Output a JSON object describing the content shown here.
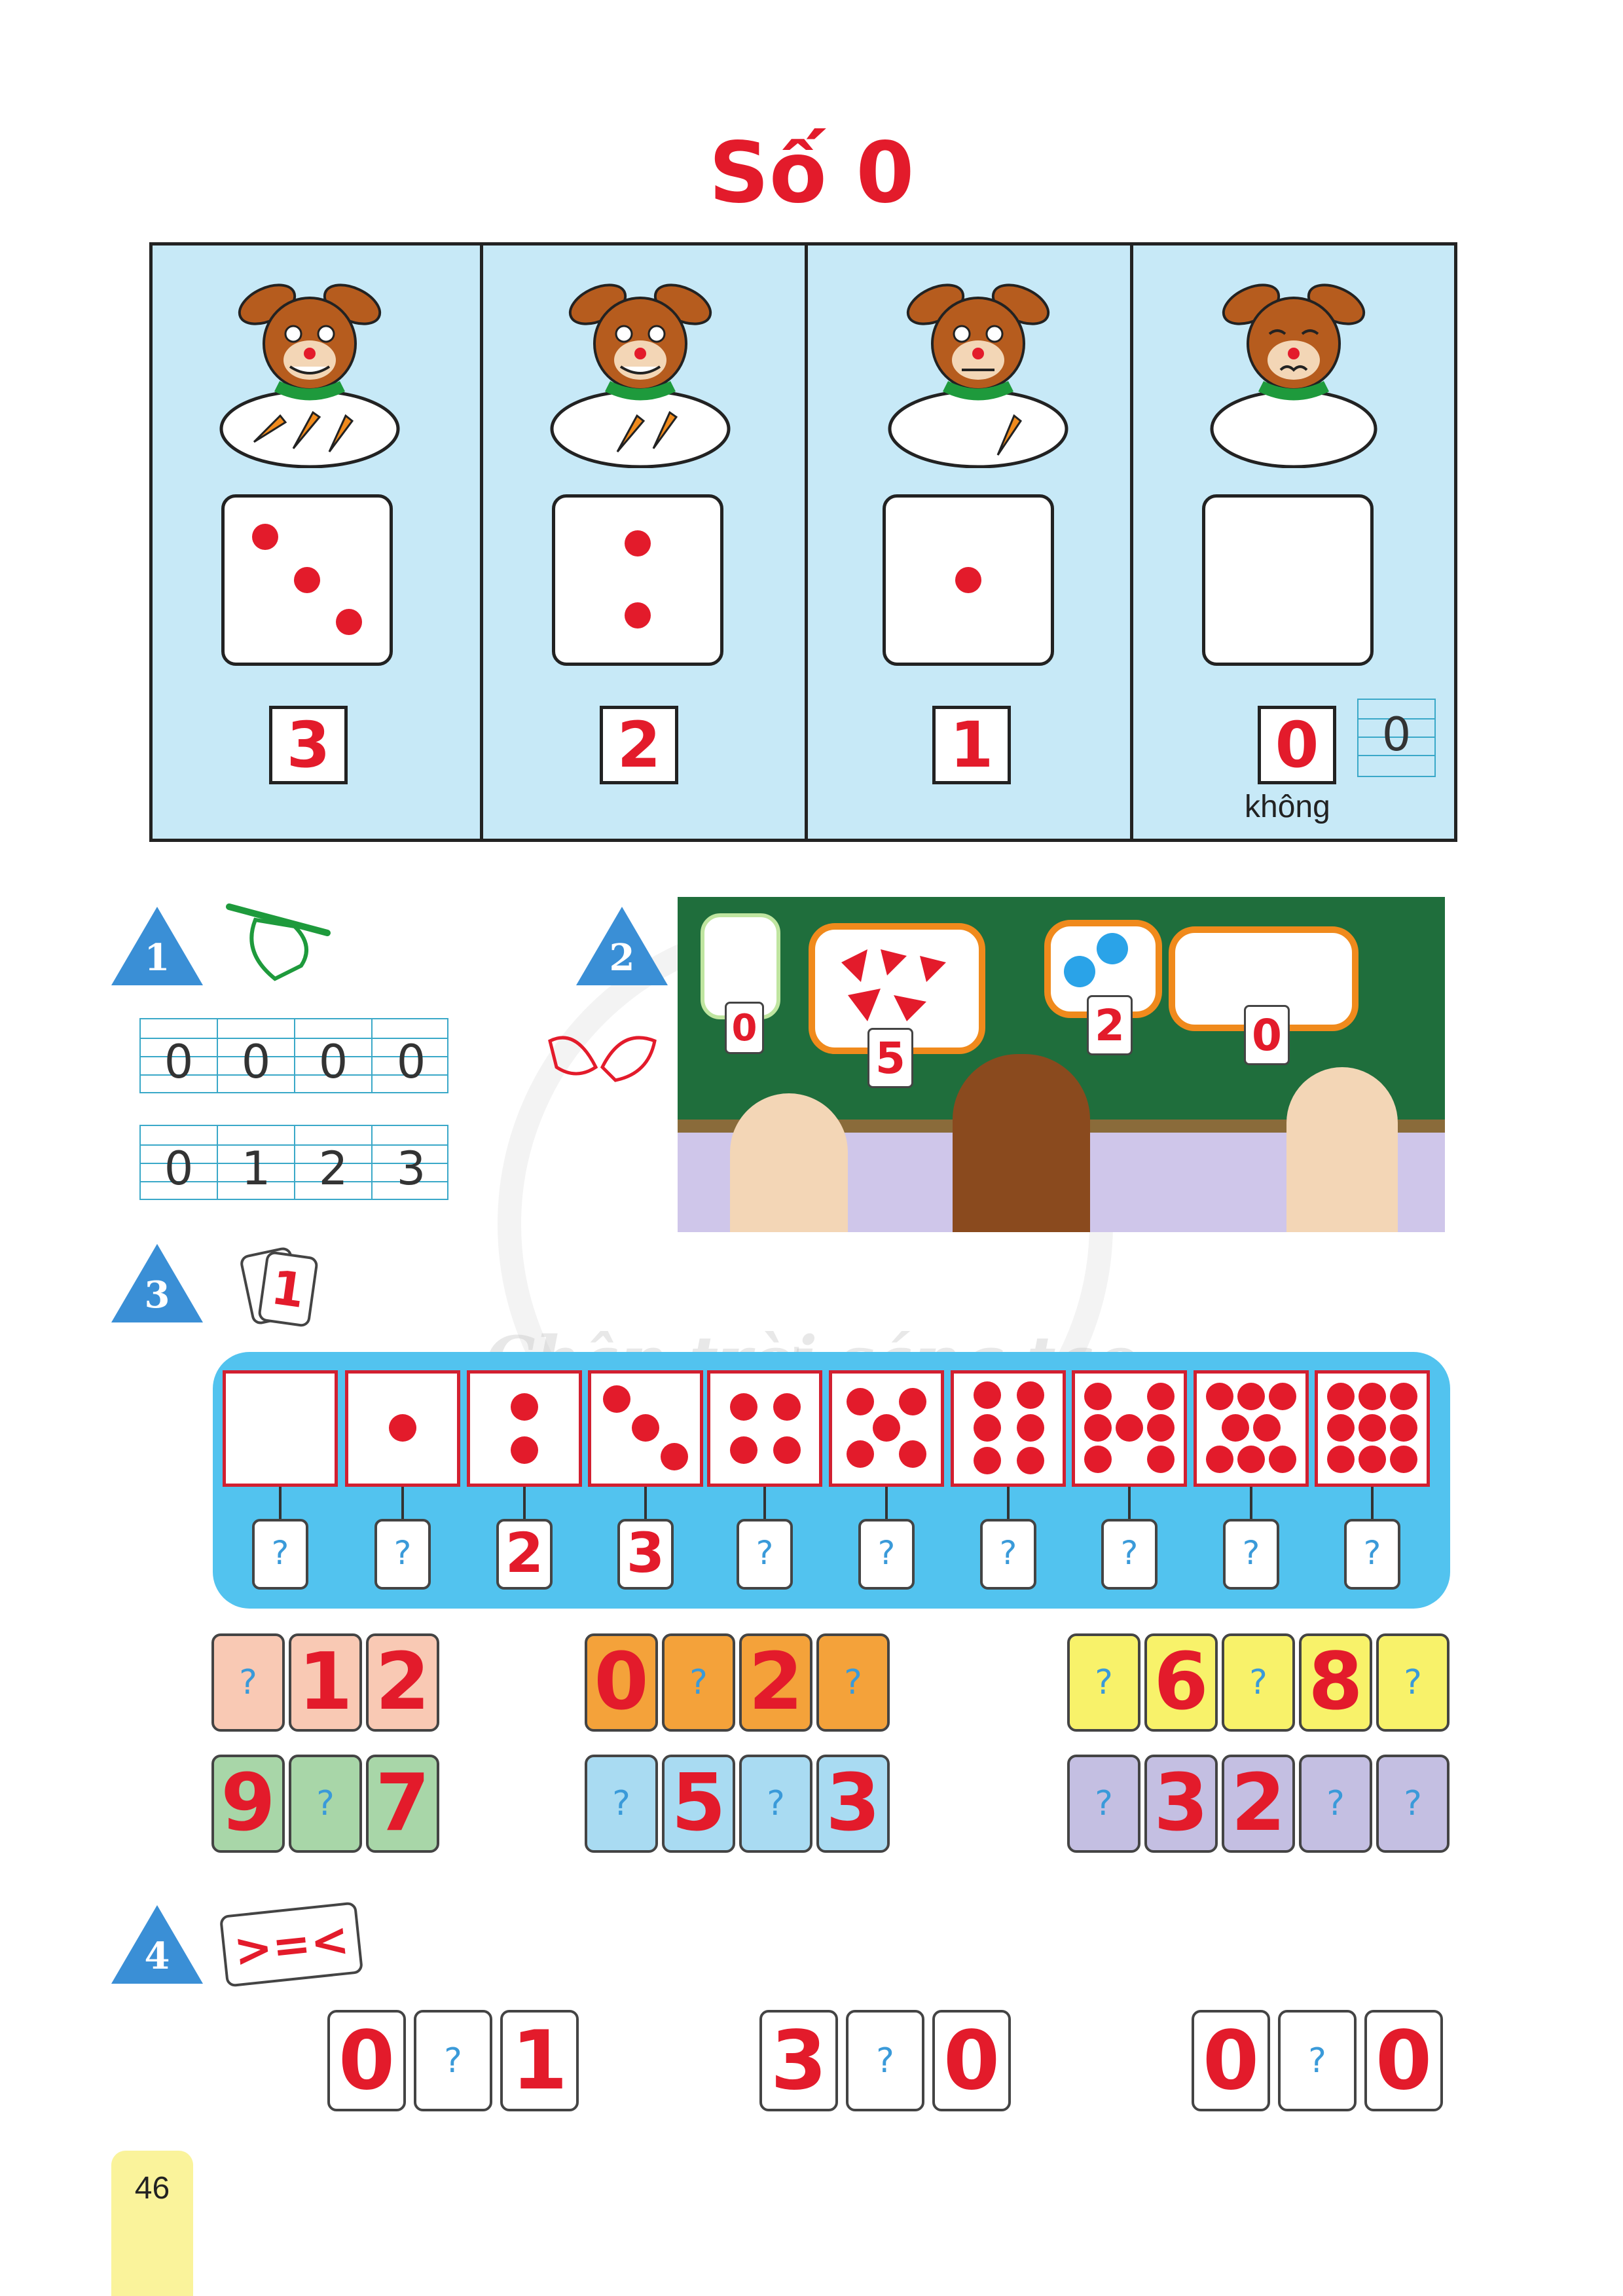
{
  "title": "Số 0",
  "hero": {
    "columns": [
      {
        "count": "3",
        "carrots": 3
      },
      {
        "count": "2",
        "carrots": 2
      },
      {
        "count": "1",
        "carrots": 1
      },
      {
        "count": "0",
        "carrots": 0,
        "word": "không",
        "write_sample": "0"
      }
    ]
  },
  "exercise1": {
    "number": "1",
    "row1": [
      "0",
      "0",
      "0",
      "0"
    ],
    "row2": [
      "0",
      "1",
      "2",
      "3"
    ]
  },
  "exercise2": {
    "number": "2",
    "cards": [
      "0",
      "5",
      "2",
      "0"
    ]
  },
  "exercise3": {
    "number": "3",
    "icon_card": "1",
    "answers": [
      "?",
      "?",
      "2",
      "3",
      "?",
      "?",
      "?",
      "?",
      "?",
      "?"
    ],
    "sequences": [
      {
        "color": "#f9c9b4",
        "items": [
          "?",
          "1",
          "2"
        ]
      },
      {
        "color": "#f4a23a",
        "items": [
          "0",
          "?",
          "2",
          "?"
        ]
      },
      {
        "color": "#f8f26a",
        "items": [
          "?",
          "6",
          "?",
          "8",
          "?"
        ]
      },
      {
        "color": "#a8d6a8",
        "items": [
          "9",
          "?",
          "7"
        ]
      },
      {
        "color": "#a9dbf2",
        "items": [
          "?",
          "5",
          "?",
          "3"
        ]
      },
      {
        "color": "#c4bfe2",
        "items": [
          "?",
          "3",
          "2",
          "?",
          "?"
        ]
      }
    ]
  },
  "exercise4": {
    "number": "4",
    "icon_signs": ">=<",
    "comparisons": [
      {
        "left": "0",
        "mid": "?",
        "right": "1"
      },
      {
        "left": "3",
        "mid": "?",
        "right": "0"
      },
      {
        "left": "0",
        "mid": "?",
        "right": "0"
      }
    ]
  },
  "page_number": "46",
  "watermark": "Chân trời sáng tạo"
}
